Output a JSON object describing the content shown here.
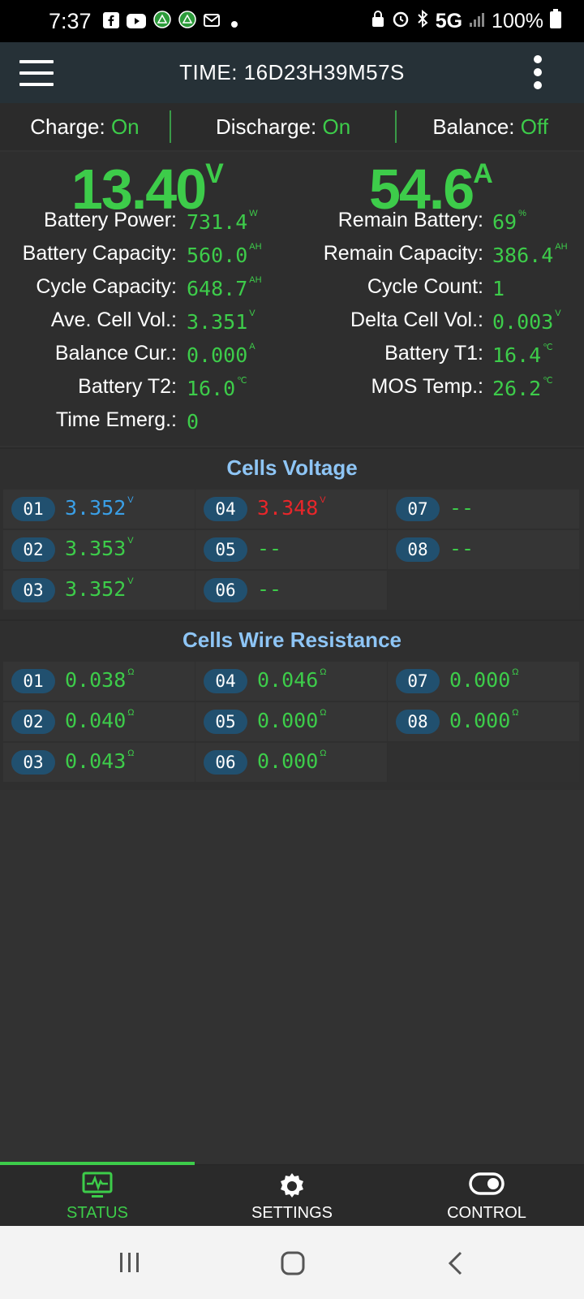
{
  "status_bar": {
    "time": "7:37",
    "network": "5G",
    "battery": "100%"
  },
  "app_bar": {
    "title": "TIME: 16D23H39M57S"
  },
  "switches": {
    "charge_label": "Charge:",
    "charge_value": "On",
    "discharge_label": "Discharge:",
    "discharge_value": "On",
    "balance_label": "Balance:",
    "balance_value": "Off"
  },
  "main": {
    "voltage": "13.40",
    "voltage_unit": "V",
    "current": "54.6",
    "current_unit": "A"
  },
  "stats_left": [
    {
      "label": "Battery Power:",
      "value": "731.4",
      "unit": "W"
    },
    {
      "label": "Battery Capacity:",
      "value": "560.0",
      "unit": "AH"
    },
    {
      "label": "Cycle Capacity:",
      "value": "648.7",
      "unit": "AH"
    },
    {
      "label": "Ave. Cell Vol.:",
      "value": "3.351",
      "unit": "V"
    },
    {
      "label": "Balance Cur.:",
      "value": "0.000",
      "unit": "A"
    },
    {
      "label": "Battery T2:",
      "value": "16.0",
      "unit": "℃"
    },
    {
      "label": "Time Emerg.:",
      "value": "0",
      "unit": ""
    }
  ],
  "stats_right": [
    {
      "label": "Remain Battery:",
      "value": "69",
      "unit": "%"
    },
    {
      "label": "Remain Capacity:",
      "value": "386.4",
      "unit": "AH"
    },
    {
      "label": "Cycle Count:",
      "value": "1",
      "unit": ""
    },
    {
      "label": "Delta Cell Vol.:",
      "value": "0.003",
      "unit": "V"
    },
    {
      "label": "Battery T1:",
      "value": "16.4",
      "unit": "℃"
    },
    {
      "label": "MOS Temp.:",
      "value": "26.2",
      "unit": "℃"
    }
  ],
  "cells_voltage": {
    "title": "Cells Voltage",
    "cells": [
      {
        "id": "01",
        "value": "3.352",
        "unit": "V",
        "color": "#3a9fe6"
      },
      {
        "id": "02",
        "value": "3.353",
        "unit": "V",
        "color": "#3dcc4a"
      },
      {
        "id": "03",
        "value": "3.352",
        "unit": "V",
        "color": "#3dcc4a"
      },
      {
        "id": "04",
        "value": "3.348",
        "unit": "V",
        "color": "#e8262a"
      },
      {
        "id": "05",
        "value": "--",
        "unit": "",
        "color": "#3dcc4a"
      },
      {
        "id": "06",
        "value": "--",
        "unit": "",
        "color": "#3dcc4a"
      },
      {
        "id": "07",
        "value": "--",
        "unit": "",
        "color": "#3dcc4a"
      },
      {
        "id": "08",
        "value": "--",
        "unit": "",
        "color": "#3dcc4a"
      }
    ]
  },
  "cells_resistance": {
    "title": "Cells Wire Resistance",
    "cells": [
      {
        "id": "01",
        "value": "0.038",
        "unit": "Ω"
      },
      {
        "id": "02",
        "value": "0.040",
        "unit": "Ω"
      },
      {
        "id": "03",
        "value": "0.043",
        "unit": "Ω"
      },
      {
        "id": "04",
        "value": "0.046",
        "unit": "Ω"
      },
      {
        "id": "05",
        "value": "0.000",
        "unit": "Ω"
      },
      {
        "id": "06",
        "value": "0.000",
        "unit": "Ω"
      },
      {
        "id": "07",
        "value": "0.000",
        "unit": "Ω"
      },
      {
        "id": "08",
        "value": "0.000",
        "unit": "Ω"
      }
    ]
  },
  "bottom_nav": {
    "items": [
      {
        "label": "STATUS",
        "icon": "monitor-pulse-icon",
        "active": true
      },
      {
        "label": "SETTINGS",
        "icon": "gear-icon",
        "active": false
      },
      {
        "label": "CONTROL",
        "icon": "toggle-icon",
        "active": false
      }
    ],
    "active_color": "#3dcc4a"
  }
}
